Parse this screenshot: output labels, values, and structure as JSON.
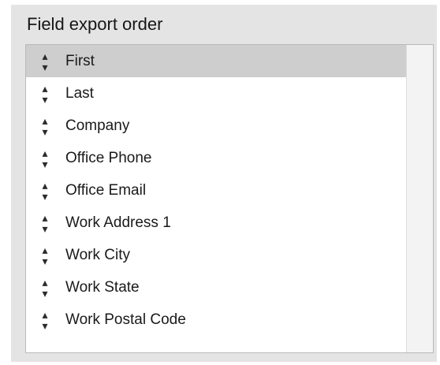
{
  "panel": {
    "title": "Field export order"
  },
  "fields": [
    {
      "label": "First",
      "selected": true
    },
    {
      "label": "Last",
      "selected": false
    },
    {
      "label": "Company",
      "selected": false
    },
    {
      "label": "Office Phone",
      "selected": false
    },
    {
      "label": "Office Email",
      "selected": false
    },
    {
      "label": "Work Address 1",
      "selected": false
    },
    {
      "label": "Work City",
      "selected": false
    },
    {
      "label": "Work State",
      "selected": false
    },
    {
      "label": "Work Postal Code",
      "selected": false
    }
  ],
  "icons": {
    "handle": "drag-handle-icon"
  },
  "colors": {
    "selected_row": "#cecece",
    "panel_bg": "#e4e4e4"
  }
}
